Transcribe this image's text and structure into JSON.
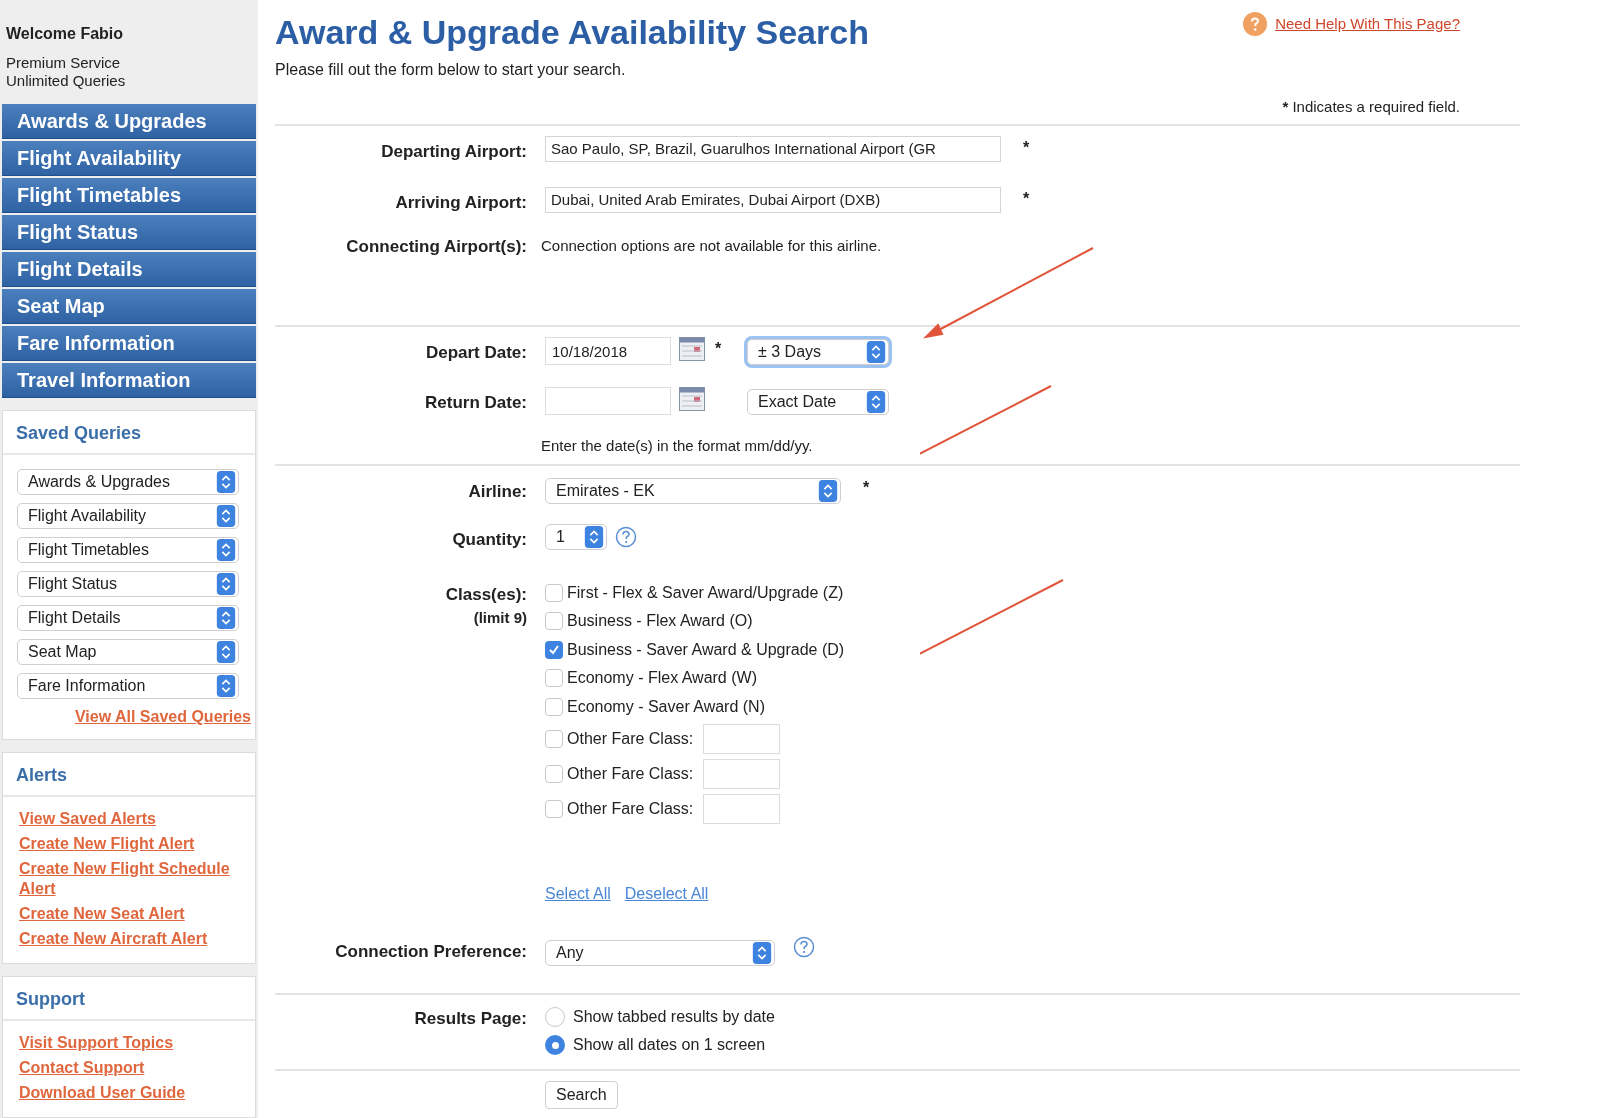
{
  "sidebar": {
    "welcome": "Welcome Fabio",
    "plan_lines": [
      "Premium Service",
      "Unlimited Queries"
    ],
    "nav": [
      "Awards & Upgrades",
      "Flight Availability",
      "Flight Timetables",
      "Flight Status",
      "Flight Details",
      "Seat Map",
      "Fare Information",
      "Travel Information"
    ],
    "saved_queries": {
      "title": "Saved Queries",
      "selects": [
        "Awards & Upgrades",
        "Flight Availability",
        "Flight Timetables",
        "Flight Status",
        "Flight Details",
        "Seat Map",
        "Fare Information"
      ],
      "view_all": "View All Saved Queries"
    },
    "alerts": {
      "title": "Alerts",
      "links": [
        "View Saved Alerts",
        "Create New Flight Alert",
        "Create New Flight Schedule Alert",
        "Create New Seat Alert",
        "Create New Aircraft Alert"
      ]
    },
    "support": {
      "title": "Support",
      "links": [
        "Visit Support Topics",
        "Contact Support",
        "Download User Guide"
      ]
    }
  },
  "main": {
    "title": "Award & Upgrade Availability Search",
    "subtitle": "Please fill out the form below to start your search.",
    "help_link": "Need Help With This Page?",
    "required_note": {
      "mark": "*",
      "text": "Indicates a required field."
    },
    "departing": {
      "label": "Departing Airport:",
      "value": "Sao Paulo, SP, Brazil, Guarulhos International Airport (GR",
      "required_mark": "*"
    },
    "arriving": {
      "label": "Arriving Airport:",
      "value": "Dubai, United Arab Emirates, Dubai Airport (DXB)",
      "required_mark": "*"
    },
    "connecting": {
      "label": "Connecting Airport(s):",
      "note": "Connection options are not available for this airline."
    },
    "depart_date": {
      "label": "Depart Date:",
      "value": "10/18/2018",
      "required_mark": "*",
      "range": "± 3 Days",
      "range_focused": true
    },
    "return_date": {
      "label": "Return Date:",
      "range": "Exact Date",
      "range_focused": false
    },
    "date_hint": "Enter the date(s) in the format mm/dd/yy.",
    "airline": {
      "label": "Airline:",
      "value": "Emirates - EK",
      "required_mark": "*"
    },
    "quantity": {
      "label": "Quantity:",
      "value": "1"
    },
    "classes": {
      "label": "Class(es):",
      "sublabel": "(limit 9)",
      "options": [
        {
          "kind": "plain",
          "label": "First - Flex & Saver Award/Upgrade (Z)",
          "checked": false
        },
        {
          "kind": "plain",
          "label": "Business - Flex Award (O)",
          "checked": false
        },
        {
          "kind": "plain",
          "label": "Business - Saver Award & Upgrade (D)",
          "checked": true
        },
        {
          "kind": "plain",
          "label": "Economy - Flex Award (W)",
          "checked": false
        },
        {
          "kind": "plain",
          "label": "Economy - Saver Award (N)",
          "checked": false
        },
        {
          "kind": "other",
          "label": "Other Fare Class:",
          "checked": false
        },
        {
          "kind": "other",
          "label": "Other Fare Class:",
          "checked": false
        },
        {
          "kind": "other",
          "label": "Other Fare Class:",
          "checked": false
        }
      ]
    },
    "select_all": "Select All",
    "deselect_all": "Deselect All",
    "connection_preference": {
      "label": "Connection Preference:",
      "value": "Any"
    },
    "results_page": {
      "label": "Results Page:",
      "options": [
        {
          "label": "Show tabbed results by date",
          "selected": false
        },
        {
          "label": "Show all dates on 1 screen",
          "selected": true
        }
      ]
    },
    "search_button": "Search"
  }
}
